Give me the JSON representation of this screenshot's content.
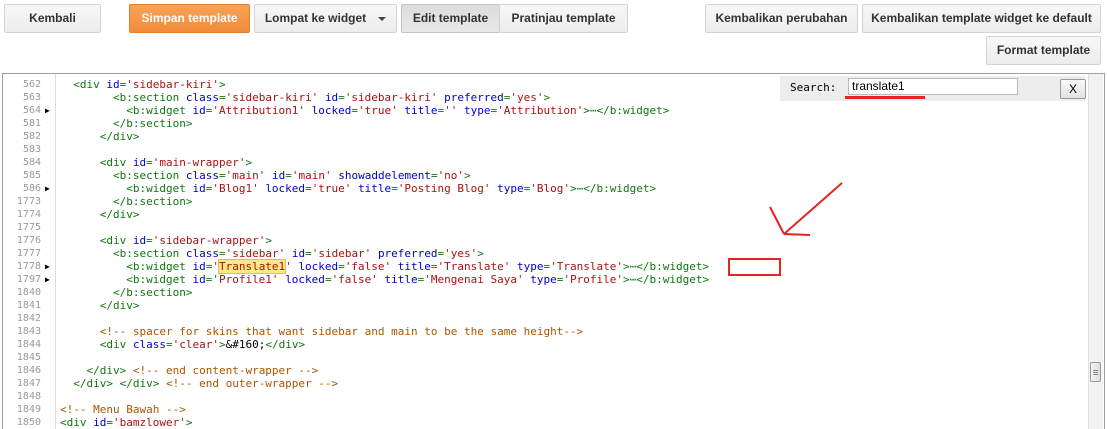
{
  "toolbar": {
    "back": "Kembali",
    "save": "Simpan template",
    "jump": "Lompat ke widget",
    "edit": "Edit template",
    "preview": "Pratinjau template",
    "revert": "Kembalikan perubahan",
    "revert_widget": "Kembalikan template widget ke default",
    "format": "Format template"
  },
  "search": {
    "label": "Search:",
    "value": "translate1",
    "close": "X"
  },
  "colors": {
    "accent": "#f39448",
    "tag": "#117711",
    "attr": "#0000cc",
    "string": "#aa1111",
    "comment": "#aa5500",
    "highlight": "#fbea83",
    "annotation": "#e0261e"
  },
  "code": [
    {
      "n": "562",
      "fold": false,
      "t": [
        [
          "t",
          "  <div "
        ],
        [
          "a",
          "id"
        ],
        [
          "t",
          "="
        ],
        [
          "s",
          "'sidebar-kiri'"
        ],
        [
          "t",
          ">"
        ]
      ]
    },
    {
      "n": "563",
      "fold": false,
      "t": [
        [
          "t",
          "        <b:section "
        ],
        [
          "a",
          "class"
        ],
        [
          "t",
          "="
        ],
        [
          "s",
          "'sidebar-kiri'"
        ],
        [
          "t",
          " "
        ],
        [
          "a",
          "id"
        ],
        [
          "t",
          "="
        ],
        [
          "s",
          "'sidebar-kiri'"
        ],
        [
          "t",
          " "
        ],
        [
          "a",
          "preferred"
        ],
        [
          "t",
          "="
        ],
        [
          "s",
          "'yes'"
        ],
        [
          "t",
          ">"
        ]
      ]
    },
    {
      "n": "564",
      "fold": true,
      "t": [
        [
          "t",
          "          <b:widget "
        ],
        [
          "a",
          "id"
        ],
        [
          "t",
          "="
        ],
        [
          "s",
          "'Attribution1'"
        ],
        [
          "t",
          " "
        ],
        [
          "a",
          "locked"
        ],
        [
          "t",
          "="
        ],
        [
          "s",
          "'true'"
        ],
        [
          "t",
          " "
        ],
        [
          "a",
          "title"
        ],
        [
          "t",
          "="
        ],
        [
          "s",
          "''"
        ],
        [
          "t",
          " "
        ],
        [
          "a",
          "type"
        ],
        [
          "t",
          "="
        ],
        [
          "s",
          "'Attribution'"
        ],
        [
          "t",
          ">⋯</b:widget>"
        ]
      ]
    },
    {
      "n": "581",
      "fold": false,
      "t": [
        [
          "t",
          "        </b:section>"
        ]
      ]
    },
    {
      "n": "582",
      "fold": false,
      "t": [
        [
          "t",
          "      </div>"
        ]
      ]
    },
    {
      "n": "583",
      "fold": false,
      "t": []
    },
    {
      "n": "584",
      "fold": false,
      "t": [
        [
          "t",
          "      <div "
        ],
        [
          "a",
          "id"
        ],
        [
          "t",
          "="
        ],
        [
          "s",
          "'main-wrapper'"
        ],
        [
          "t",
          ">"
        ]
      ]
    },
    {
      "n": "585",
      "fold": false,
      "t": [
        [
          "t",
          "        <b:section "
        ],
        [
          "a",
          "class"
        ],
        [
          "t",
          "="
        ],
        [
          "s",
          "'main'"
        ],
        [
          "t",
          " "
        ],
        [
          "a",
          "id"
        ],
        [
          "t",
          "="
        ],
        [
          "s",
          "'main'"
        ],
        [
          "t",
          " "
        ],
        [
          "a",
          "showaddelement"
        ],
        [
          "t",
          "="
        ],
        [
          "s",
          "'no'"
        ],
        [
          "t",
          ">"
        ]
      ]
    },
    {
      "n": "586",
      "fold": true,
      "t": [
        [
          "t",
          "          <b:widget "
        ],
        [
          "a",
          "id"
        ],
        [
          "t",
          "="
        ],
        [
          "s",
          "'Blog1'"
        ],
        [
          "t",
          " "
        ],
        [
          "a",
          "locked"
        ],
        [
          "t",
          "="
        ],
        [
          "s",
          "'true'"
        ],
        [
          "t",
          " "
        ],
        [
          "a",
          "title"
        ],
        [
          "t",
          "="
        ],
        [
          "s",
          "'Posting Blog'"
        ],
        [
          "t",
          " "
        ],
        [
          "a",
          "type"
        ],
        [
          "t",
          "="
        ],
        [
          "s",
          "'Blog'"
        ],
        [
          "t",
          ">⋯</b:widget>"
        ]
      ]
    },
    {
      "n": "1773",
      "fold": false,
      "t": [
        [
          "t",
          "        </b:section>"
        ]
      ]
    },
    {
      "n": "1774",
      "fold": false,
      "t": [
        [
          "t",
          "      </div>"
        ]
      ]
    },
    {
      "n": "1775",
      "fold": false,
      "t": []
    },
    {
      "n": "1776",
      "fold": false,
      "t": [
        [
          "t",
          "      <div "
        ],
        [
          "a",
          "id"
        ],
        [
          "t",
          "="
        ],
        [
          "s",
          "'sidebar-wrapper'"
        ],
        [
          "t",
          ">"
        ]
      ]
    },
    {
      "n": "1777",
      "fold": false,
      "t": [
        [
          "t",
          "        <b:section "
        ],
        [
          "a",
          "class"
        ],
        [
          "t",
          "="
        ],
        [
          "s",
          "'sidebar'"
        ],
        [
          "t",
          " "
        ],
        [
          "a",
          "id"
        ],
        [
          "t",
          "="
        ],
        [
          "s",
          "'sidebar'"
        ],
        [
          "t",
          " "
        ],
        [
          "a",
          "preferred"
        ],
        [
          "t",
          "="
        ],
        [
          "s",
          "'yes'"
        ],
        [
          "t",
          ">"
        ]
      ]
    },
    {
      "n": "1778",
      "fold": true,
      "t": [
        [
          "t",
          "          <b:widget "
        ],
        [
          "a",
          "id"
        ],
        [
          "t",
          "="
        ],
        [
          "s",
          "'"
        ],
        [
          "h",
          "Translate1"
        ],
        [
          "s",
          "'"
        ],
        [
          "t",
          " "
        ],
        [
          "a",
          "locked"
        ],
        [
          "t",
          "="
        ],
        [
          "s",
          "'false'"
        ],
        [
          "t",
          " "
        ],
        [
          "a",
          "title"
        ],
        [
          "t",
          "="
        ],
        [
          "s",
          "'Translate'"
        ],
        [
          "t",
          " "
        ],
        [
          "a",
          "type"
        ],
        [
          "t",
          "="
        ],
        [
          "s",
          "'Translate'"
        ],
        [
          "t",
          ">⋯</b:widget>"
        ]
      ]
    },
    {
      "n": "1797",
      "fold": true,
      "t": [
        [
          "t",
          "          <b:widget "
        ],
        [
          "a",
          "id"
        ],
        [
          "t",
          "="
        ],
        [
          "s",
          "'Profile1'"
        ],
        [
          "t",
          " "
        ],
        [
          "a",
          "locked"
        ],
        [
          "t",
          "="
        ],
        [
          "s",
          "'false'"
        ],
        [
          "t",
          " "
        ],
        [
          "a",
          "title"
        ],
        [
          "t",
          "="
        ],
        [
          "s",
          "'Mengenai Saya'"
        ],
        [
          "t",
          " "
        ],
        [
          "a",
          "type"
        ],
        [
          "t",
          "="
        ],
        [
          "s",
          "'Profile'"
        ],
        [
          "t",
          ">⋯</b:widget>"
        ]
      ]
    },
    {
      "n": "1840",
      "fold": false,
      "t": [
        [
          "t",
          "        </b:section>"
        ]
      ]
    },
    {
      "n": "1841",
      "fold": false,
      "t": [
        [
          "t",
          "      </div>"
        ]
      ]
    },
    {
      "n": "1842",
      "fold": false,
      "t": []
    },
    {
      "n": "1843",
      "fold": false,
      "t": [
        [
          "c",
          "      <!-- spacer for skins that want sidebar and main to be the same height-->"
        ]
      ]
    },
    {
      "n": "1844",
      "fold": false,
      "t": [
        [
          "t",
          "      <div "
        ],
        [
          "a",
          "class"
        ],
        [
          "t",
          "="
        ],
        [
          "s",
          "'clear'"
        ],
        [
          "t",
          ">"
        ],
        [
          "e",
          "&#160;"
        ],
        [
          "t",
          "</div>"
        ]
      ]
    },
    {
      "n": "1845",
      "fold": false,
      "t": []
    },
    {
      "n": "1846",
      "fold": false,
      "t": [
        [
          "t",
          "    </div> "
        ],
        [
          "c",
          "<!-- end content-wrapper -->"
        ]
      ]
    },
    {
      "n": "1847",
      "fold": false,
      "t": [
        [
          "t",
          "  </div> </div> "
        ],
        [
          "c",
          "<!-- end outer-wrapper -->"
        ]
      ]
    },
    {
      "n": "1848",
      "fold": false,
      "t": []
    },
    {
      "n": "1849",
      "fold": false,
      "t": [
        [
          "c",
          "<!-- Menu Bawah -->"
        ]
      ]
    },
    {
      "n": "1850",
      "fold": false,
      "t": [
        [
          "t",
          "<div "
        ],
        [
          "a",
          "id"
        ],
        [
          "t",
          "="
        ],
        [
          "s",
          "'bamzlower'"
        ],
        [
          "t",
          ">"
        ]
      ]
    }
  ]
}
